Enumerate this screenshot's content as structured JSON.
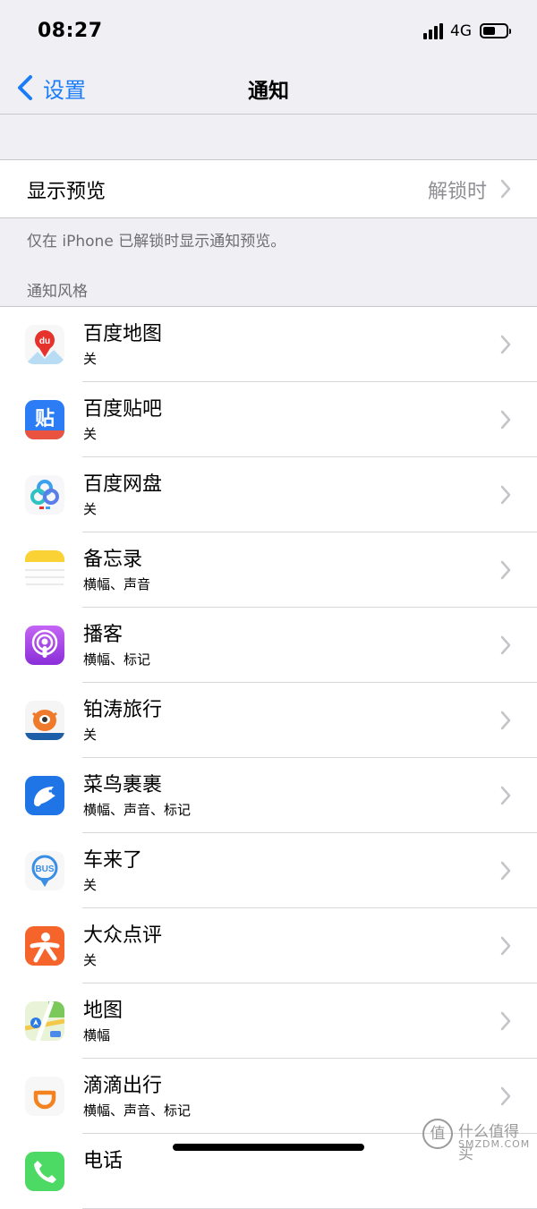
{
  "status_bar": {
    "time": "08:27",
    "network": "4G"
  },
  "navbar": {
    "back_label": "设置",
    "title": "通知"
  },
  "preview": {
    "label": "显示预览",
    "value": "解锁时"
  },
  "footnote": "仅在 iPhone 已解锁时显示通知预览。",
  "section_header": "通知风格",
  "apps": [
    {
      "name": "百度地图",
      "detail": "关",
      "icon": "baidu-map-icon"
    },
    {
      "name": "百度贴吧",
      "detail": "关",
      "icon": "baidu-tieba-icon",
      "icon_text": "贴"
    },
    {
      "name": "百度网盘",
      "detail": "关",
      "icon": "baidu-netdisk-icon"
    },
    {
      "name": "备忘录",
      "detail": "横幅、声音",
      "icon": "notes-icon"
    },
    {
      "name": "播客",
      "detail": "横幅、标记",
      "icon": "podcasts-icon"
    },
    {
      "name": "铂涛旅行",
      "detail": "关",
      "icon": "botao-travel-icon"
    },
    {
      "name": "菜鸟裹裹",
      "detail": "横幅、声音、标记",
      "icon": "cainiao-guoguo-icon"
    },
    {
      "name": "车来了",
      "detail": "关",
      "icon": "chelaile-bus-icon",
      "icon_text": "BUS"
    },
    {
      "name": "大众点评",
      "detail": "关",
      "icon": "dianping-icon"
    },
    {
      "name": "地图",
      "detail": "横幅",
      "icon": "apple-maps-icon"
    },
    {
      "name": "滴滴出行",
      "detail": "横幅、声音、标记",
      "icon": "didi-icon"
    },
    {
      "name": "电话",
      "detail": "",
      "icon": "phone-icon"
    }
  ],
  "watermark": {
    "text": "什么值得买",
    "sub": "SMZDM.COM",
    "badge": "值"
  },
  "colors": {
    "accent": "#1a7df7",
    "background": "#efeff4",
    "separator": "#c8c7cc"
  }
}
